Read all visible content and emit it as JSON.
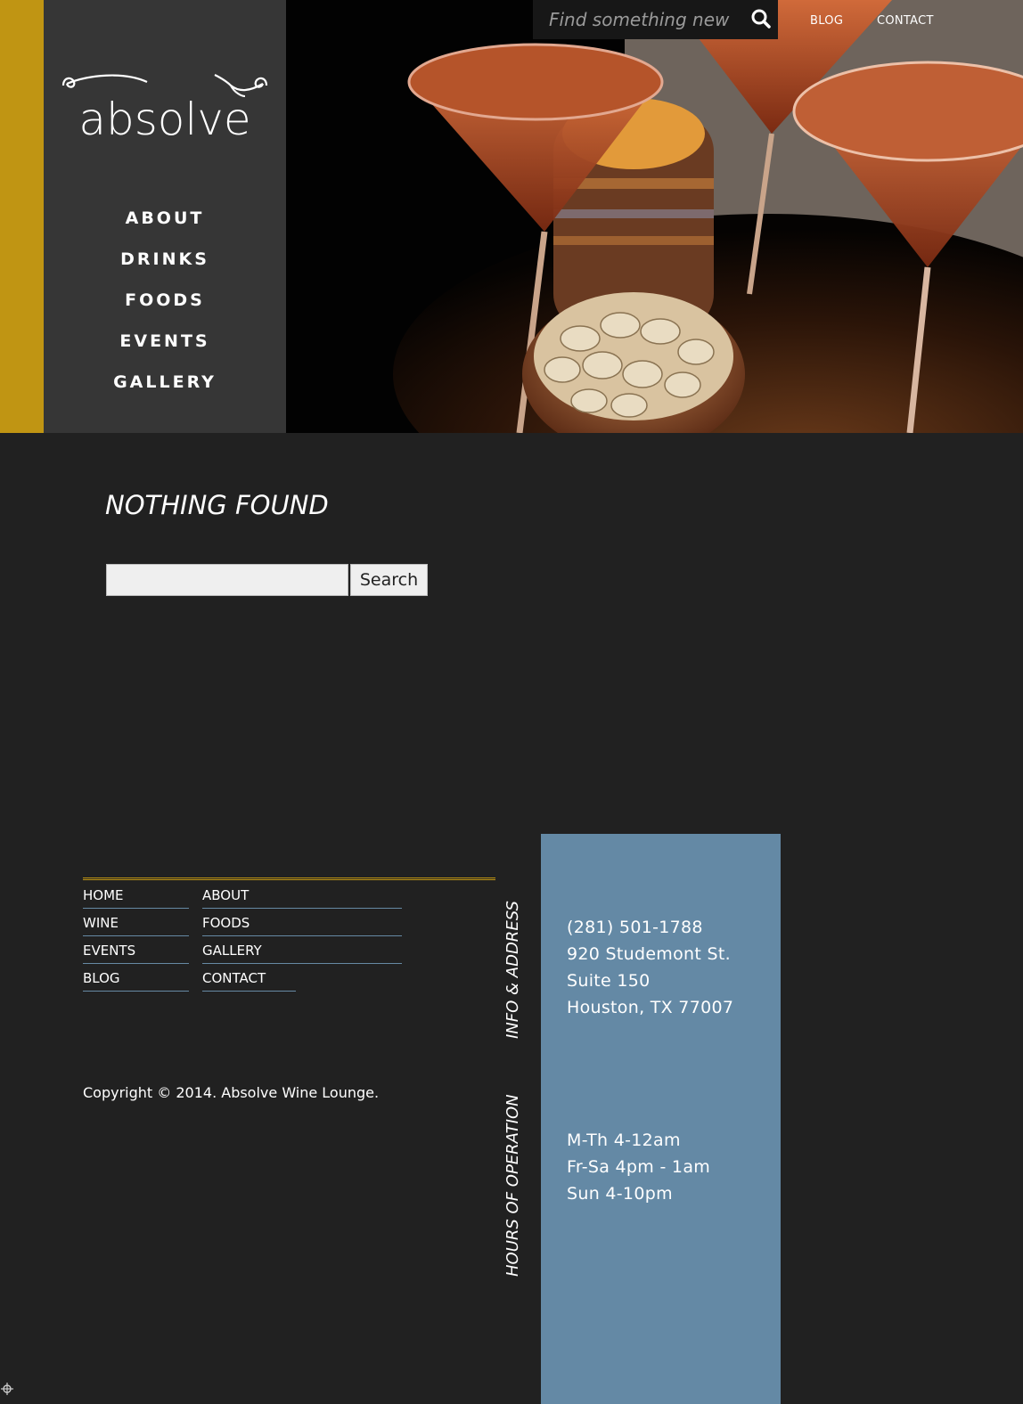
{
  "brand": {
    "logo_text": "absolve"
  },
  "main_nav": [
    {
      "label": "ABOUT"
    },
    {
      "label": "DRINKS"
    },
    {
      "label": "FOODS"
    },
    {
      "label": "EVENTS"
    },
    {
      "label": "GALLERY"
    }
  ],
  "top_search": {
    "placeholder": "Find something new"
  },
  "top_links": {
    "blog": "BLOG",
    "contact": "CONTACT"
  },
  "content": {
    "title": "NOTHING FOUND",
    "search_input_value": "",
    "search_button": "Search"
  },
  "footer_nav": {
    "col1": [
      "HOME",
      "WINE",
      "EVENTS",
      "BLOG"
    ],
    "col2": [
      "ABOUT",
      "FOODS",
      "GALLERY",
      "CONTACT"
    ]
  },
  "copyright": "Copyright © 2014. Absolve Wine Lounge.",
  "info": {
    "label": "INFO & ADDRESS",
    "phone": "(281) 501-1788",
    "street": "920 Studemont St.",
    "suite": "Suite 150",
    "city": "Houston, TX 77007"
  },
  "hours": {
    "label": "HOURS OF OPERATION",
    "lines": [
      "M-Th 4-12am",
      "Fr-Sa 4pm - 1am",
      "Sun 4-10pm"
    ]
  },
  "colors": {
    "gold": "#c09513",
    "panel_blue": "#6489a5",
    "link_underline": "#6689a4",
    "page_bg": "#212121",
    "side_panel": "#363636"
  },
  "icons": [
    "search-icon",
    "logo-flourish",
    "corner-move-icon"
  ]
}
